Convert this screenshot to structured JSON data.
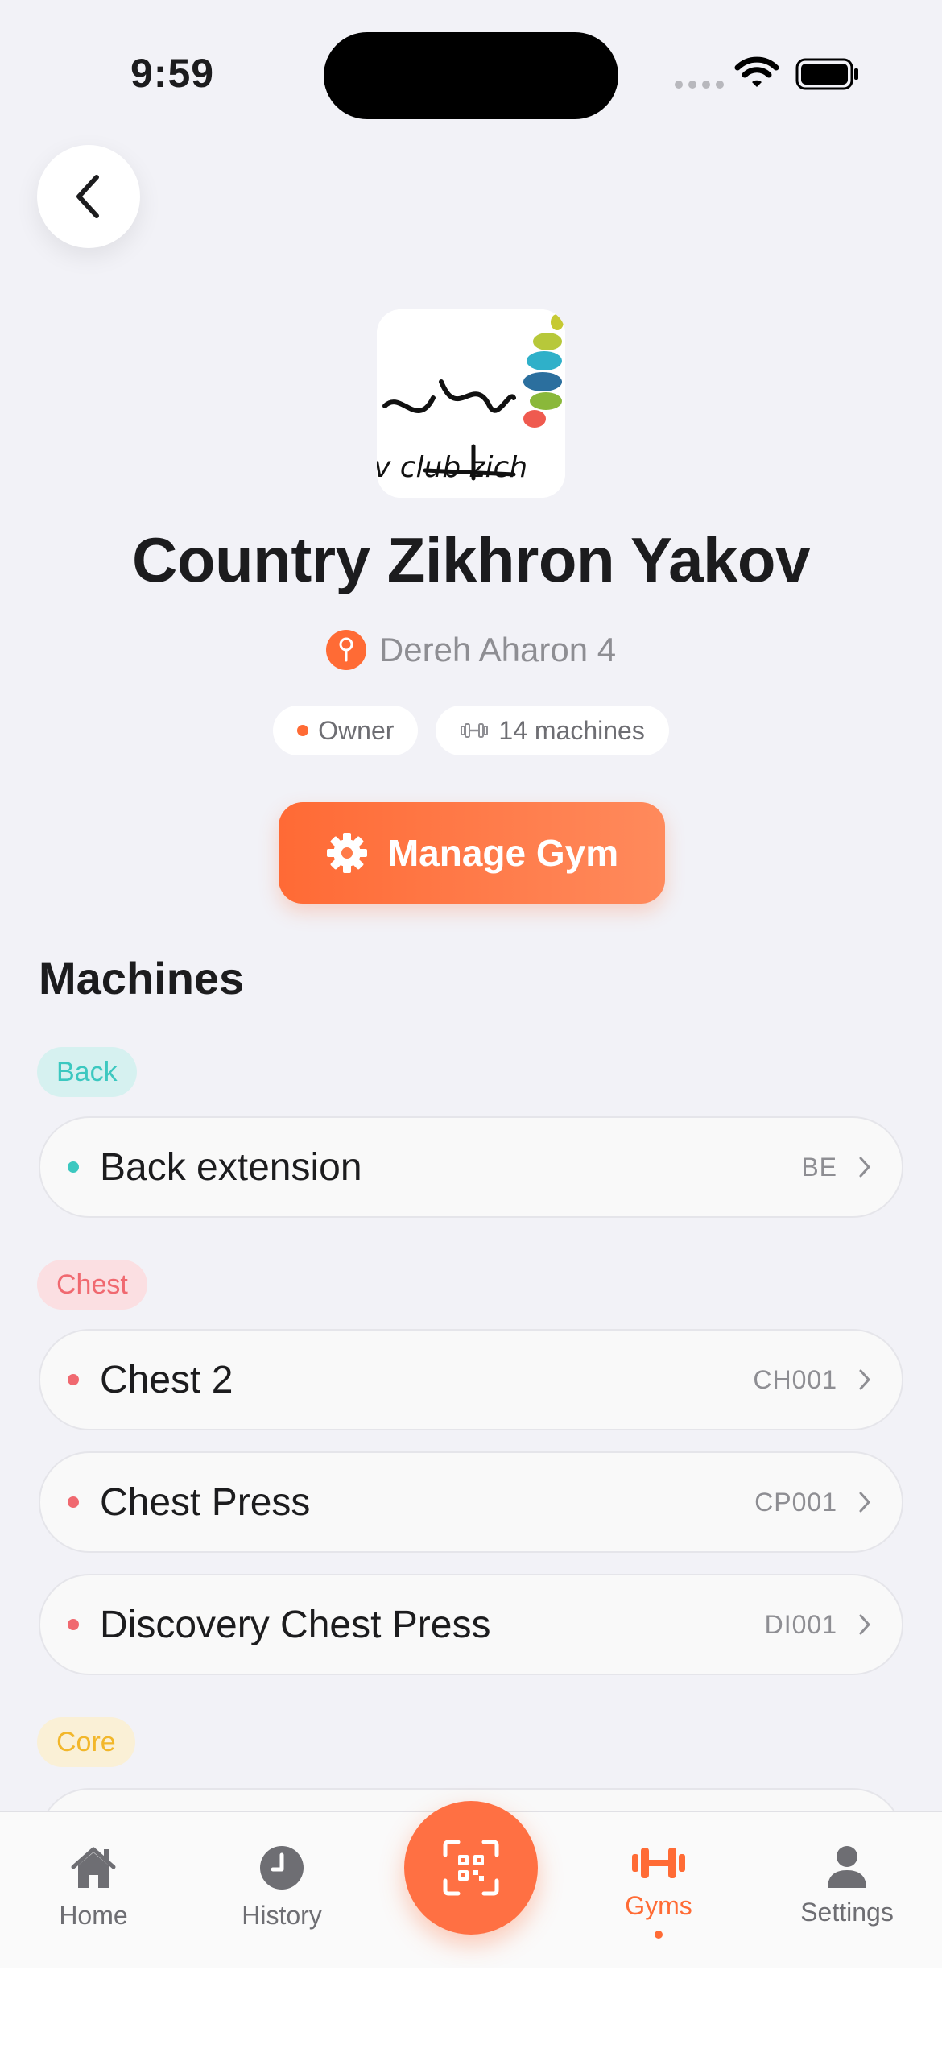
{
  "status_bar": {
    "time": "9:59"
  },
  "gym": {
    "name": "Country Zikhron Yakov",
    "address": "Dereh Aharon 4",
    "logo_text": "v club zich",
    "role": "Owner",
    "machines_count": "14 machines"
  },
  "actions": {
    "manage_label": "Manage Gym"
  },
  "machines_section": {
    "title": "Machines",
    "categories": [
      {
        "label": "Back",
        "color": "#3cc8c0",
        "items": [
          {
            "name": "Back extension",
            "code": "BE"
          }
        ]
      },
      {
        "label": "Chest",
        "color": "#f06970",
        "items": [
          {
            "name": "Chest 2",
            "code": "CH001"
          },
          {
            "name": "Chest Press",
            "code": "CP001"
          },
          {
            "name": "Discovery Chest Press",
            "code": "DI001"
          }
        ]
      },
      {
        "label": "Core",
        "color": "#f2b72b",
        "items": []
      }
    ]
  },
  "tabbar": {
    "home": "Home",
    "history": "History",
    "gyms": "Gyms",
    "settings": "Settings",
    "active": "Gyms"
  },
  "colors": {
    "accent": "#ff6b35",
    "background": "#f2f2f7"
  },
  "icons": {
    "back": "chevron-left-icon",
    "pin": "location-pin-icon",
    "dumbbell": "dumbbell-icon",
    "gear": "gear-icon",
    "scan": "qr-scan-icon"
  }
}
